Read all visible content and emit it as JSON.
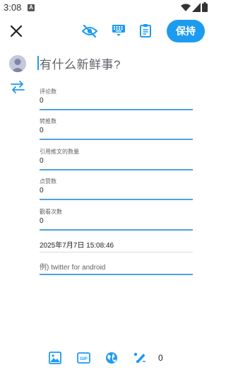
{
  "status_bar": {
    "time": "3:08",
    "notification_badge": "A"
  },
  "toolbar": {
    "save_label": "保持",
    "accent_color": "#1d9bf0",
    "icons": [
      "close-icon",
      "eye-off-icon",
      "keyboard-icon",
      "clipboard-icon"
    ]
  },
  "compose": {
    "placeholder": "有什么新鲜事?"
  },
  "fields": [
    {
      "label": "评论数",
      "value": "0"
    },
    {
      "label": "转推数",
      "value": "0"
    },
    {
      "label": "引用推文的数量",
      "value": "0"
    },
    {
      "label": "点赞数",
      "value": "0"
    },
    {
      "label": "觀看次數",
      "value": "0"
    }
  ],
  "datetime": "2025年7月7日 15:08:46",
  "source": {
    "placeholder": "例) twitter for android"
  },
  "bottom_bar": {
    "gif_label": "GIF",
    "char_count": "0",
    "icons": [
      "image-icon",
      "gif-icon",
      "globe-icon",
      "draft-edit-icon"
    ]
  }
}
